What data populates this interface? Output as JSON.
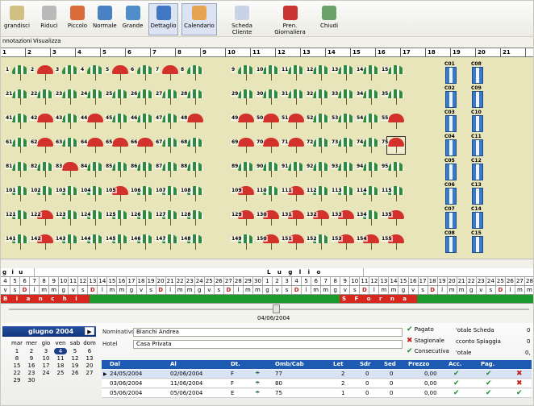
{
  "toolbar": {
    "items": [
      {
        "label": "grandisci",
        "icon": "zoom-in-icon",
        "color": "#d2c083"
      },
      {
        "label": "Riduci",
        "icon": "zoom-out-icon",
        "color": "#b9b9b9"
      },
      {
        "label": "Piccolo",
        "icon": "small-view-icon",
        "color": "#d96a3a"
      },
      {
        "label": "Normale",
        "icon": "normal-view-icon",
        "color": "#4a80c4"
      },
      {
        "label": "Grande",
        "icon": "large-view-icon",
        "color": "#4f8ec8"
      },
      {
        "label": "Dettaglio",
        "icon": "detail-person-icon",
        "color": "#3f77c2"
      },
      {
        "label": "Calendario",
        "icon": "calendar-icon",
        "color": "#e6a453"
      },
      {
        "label": "Scheda Cliente",
        "icon": "customer-card-icon",
        "color": "#c9d3e8"
      },
      {
        "label": "Pren. Giornaliera",
        "icon": "daily-booking-icon",
        "color": "#c33"
      },
      {
        "label": "Chiudi",
        "icon": "close-door-icon",
        "color": "#6da36a"
      }
    ]
  },
  "menu": {
    "items": [
      "nnotazioni",
      "Visualizza"
    ]
  },
  "day_columns": [
    "1",
    "2",
    "3",
    "4",
    "5",
    "6",
    "7",
    "8",
    "9",
    "10",
    "11",
    "12",
    "13",
    "14",
    "15",
    "16",
    "17",
    "18",
    "19",
    "20",
    "21"
  ],
  "umbrella_rows": [
    {
      "numbers": [
        "1",
        "2",
        "3",
        "4",
        "5",
        "6",
        "7",
        "8",
        "",
        "9",
        "10",
        "11",
        "12",
        "13",
        "14",
        "15"
      ],
      "colors": [
        "g",
        "r",
        "g",
        "g",
        "r",
        "g",
        "r",
        "g",
        "",
        "g",
        "g",
        "g",
        "g",
        "g",
        "g",
        "g"
      ]
    },
    {
      "numbers": [
        "21",
        "22",
        "23",
        "24",
        "25",
        "26",
        "27",
        "28",
        "",
        "29",
        "30",
        "31",
        "32",
        "33",
        "34",
        "35"
      ],
      "colors": [
        "g",
        "g",
        "g",
        "g",
        "g",
        "g",
        "g",
        "g",
        "",
        "g",
        "g",
        "g",
        "g",
        "g",
        "g",
        "g"
      ]
    },
    {
      "numbers": [
        "41",
        "42",
        "43",
        "44",
        "45",
        "46",
        "47",
        "48",
        "",
        "49",
        "50",
        "51",
        "52",
        "53",
        "54",
        "55"
      ],
      "colors": [
        "g",
        "r",
        "g",
        "r",
        "g",
        "g",
        "g",
        "r",
        "",
        "r",
        "r",
        "r",
        "g",
        "g",
        "g",
        "r"
      ]
    },
    {
      "numbers": [
        "61",
        "62",
        "63",
        "64",
        "65",
        "66",
        "67",
        "68",
        "",
        "69",
        "70",
        "71",
        "72",
        "73",
        "74",
        "75"
      ],
      "colors": [
        "g",
        "r",
        "g",
        "r",
        "r",
        "r",
        "g",
        "g",
        "",
        "r",
        "r",
        "r",
        "g",
        "g",
        "g",
        "r"
      ]
    },
    {
      "numbers": [
        "81",
        "82",
        "83",
        "84",
        "85",
        "86",
        "87",
        "88",
        "",
        "89",
        "90",
        "91",
        "92",
        "93",
        "94",
        "95"
      ],
      "colors": [
        "g",
        "g",
        "r",
        "g",
        "g",
        "g",
        "g",
        "g",
        "",
        "g",
        "g",
        "g",
        "g",
        "g",
        "g",
        "g"
      ]
    },
    {
      "numbers": [
        "101",
        "102",
        "103",
        "104",
        "105",
        "106",
        "107",
        "108",
        "",
        "109",
        "110",
        "111",
        "112",
        "113",
        "114",
        "115"
      ],
      "colors": [
        "g",
        "g",
        "g",
        "g",
        "r",
        "g",
        "g",
        "g",
        "",
        "r",
        "g",
        "r",
        "g",
        "g",
        "g",
        "g"
      ]
    },
    {
      "numbers": [
        "121",
        "122",
        "123",
        "124",
        "125",
        "126",
        "127",
        "128",
        "",
        "129",
        "130",
        "131",
        "132",
        "133",
        "134",
        "135"
      ],
      "colors": [
        "g",
        "r",
        "g",
        "g",
        "g",
        "g",
        "g",
        "g",
        "",
        "r",
        "r",
        "r",
        "r",
        "r",
        "g",
        "r"
      ]
    },
    {
      "numbers": [
        "141",
        "142",
        "143",
        "144",
        "145",
        "146",
        "147",
        "148",
        "",
        "149",
        "150",
        "151",
        "152",
        "153",
        "154",
        "155"
      ],
      "colors": [
        "g",
        "r",
        "g",
        "g",
        "g",
        "g",
        "g",
        "g",
        "",
        "g",
        "r",
        "r",
        "g",
        "r",
        "r",
        "r"
      ]
    }
  ],
  "selected_umbrella": "75",
  "cabins": [
    {
      "col": 0,
      "labels": [
        "C01",
        "C02",
        "C03",
        "C04",
        "C05",
        "C06",
        "C07",
        "C08"
      ]
    },
    {
      "col": 1,
      "labels": [
        "C08",
        "C09",
        "C10",
        "C11",
        "C12",
        "C13",
        "C14",
        "C15"
      ]
    }
  ],
  "calendar": {
    "month_labels": {
      "june": "g i u",
      "july": "L u g l i o"
    },
    "numbers": [
      "4",
      "5",
      "6",
      "7",
      "8",
      "9",
      "10",
      "11",
      "12",
      "13",
      "14",
      "15",
      "16",
      "17",
      "18",
      "19",
      "20",
      "21",
      "22",
      "23",
      "24",
      "25",
      "26",
      "27",
      "28",
      "29",
      "30",
      "1",
      "2",
      "3",
      "4",
      "5",
      "6",
      "7",
      "8",
      "9",
      "10",
      "11",
      "12",
      "13",
      "14",
      "15",
      "16",
      "17",
      "18",
      "19",
      "20",
      "21",
      "22",
      "23",
      "24",
      "25",
      "26",
      "27",
      "28"
    ],
    "weekdays": [
      "v",
      "s",
      "D",
      "l",
      "m",
      "m",
      "g",
      "v",
      "s",
      "D",
      "l",
      "m",
      "m",
      "g",
      "v",
      "s",
      "D",
      "l",
      "m",
      "m",
      "g",
      "v",
      "s",
      "D",
      "l",
      "m",
      "m",
      "g",
      "v",
      "s",
      "D",
      "l",
      "m",
      "m",
      "g",
      "v",
      "s",
      "D",
      "l",
      "m",
      "m",
      "g",
      "v",
      "s",
      "D",
      "l",
      "m",
      "m",
      "g",
      "v",
      "s",
      "D",
      "l",
      "m",
      "m"
    ],
    "band1": "B i a n c h i",
    "band2": "S F o r n a c i S",
    "colors": {
      "red": "#d8271f",
      "green": "#1a9a2a"
    }
  },
  "slider": {
    "date": "04/06/2004"
  },
  "minical": {
    "month": "giugno 2004",
    "weekday_headers": [
      "mar",
      "mer",
      "gio",
      "ven",
      "sab",
      "dom"
    ],
    "rows": [
      [
        "1",
        "2",
        "3",
        "4",
        "5",
        "6"
      ],
      [
        "8",
        "9",
        "10",
        "11",
        "12",
        "13"
      ],
      [
        "15",
        "16",
        "17",
        "18",
        "19",
        "20"
      ],
      [
        "22",
        "23",
        "24",
        "25",
        "26",
        "27"
      ],
      [
        "29",
        "30",
        "",
        "",
        "",
        ""
      ]
    ],
    "selected": "4"
  },
  "form": {
    "nominativo_label": "Nominativo",
    "nominativo_value": "Bianchi Andrea",
    "hotel_label": "Hotel",
    "hotel_value": "Casa Privata",
    "pagato": "Pagato",
    "stagionale": "Stagionale",
    "consecutiva": "Consecutiva",
    "totale_scheda": "'otale Scheda",
    "acconto": "cconto Spiaggia",
    "totale": "'otale",
    "totale_scheda_val": "0",
    "acconto_val": "0",
    "totale_val": "0,"
  },
  "table": {
    "headers": [
      "Dal",
      "Al",
      "Dt.",
      "",
      "Omb/Cab",
      "Let",
      "Sdr",
      "Sed",
      "Prezzo",
      "Acc.",
      "Pag."
    ],
    "rows": [
      {
        "dal": "24/05/2004",
        "al": "02/06/2004",
        "dt": "F",
        "omb": "77",
        "let": "2",
        "sdr": "0",
        "sed": "0",
        "prezzo": "0,00",
        "acc": true,
        "pag": true,
        "del": true
      },
      {
        "dal": "03/06/2004",
        "al": "11/06/2004",
        "dt": "F",
        "omb": "80",
        "let": "2",
        "sdr": "0",
        "sed": "0",
        "prezzo": "0,00",
        "acc": true,
        "pag": true,
        "del": true
      },
      {
        "dal": "05/06/2004",
        "al": "05/06/2004",
        "dt": "E",
        "omb": "75",
        "let": "1",
        "sdr": "0",
        "sed": "0",
        "prezzo": "0,00",
        "acc": true,
        "pag": true,
        "del": false
      }
    ]
  }
}
